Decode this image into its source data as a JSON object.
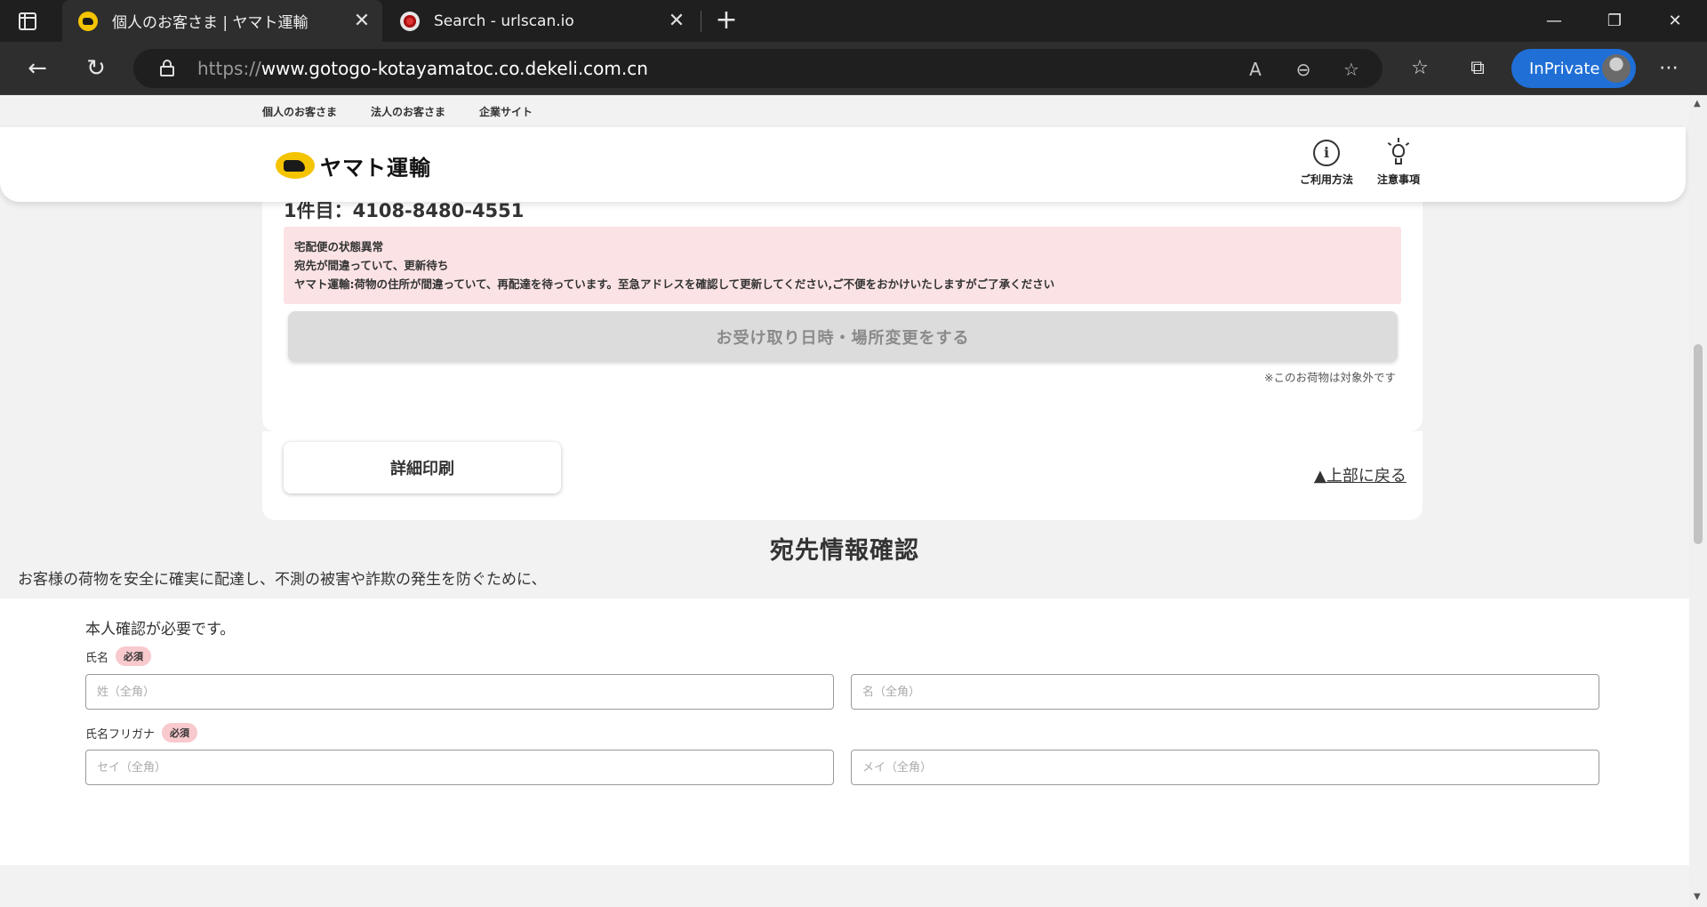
{
  "browser": {
    "tabs": [
      {
        "title": "個人のお客さま | ヤマト運輸",
        "favicon": "yamato-cat-icon",
        "active": true
      },
      {
        "title": "Search - urlscan.io",
        "favicon": "urlscan-icon",
        "active": false
      }
    ],
    "url_scheme": "https://",
    "url_host": "www.gotogo-kotayamatoc.co.dekeli.com.cn",
    "inprivate_label": "InPrivate"
  },
  "topnav": {
    "items": [
      "個人のお客さま",
      "法人のお客さま",
      "企業サイト"
    ]
  },
  "header": {
    "logo_text": "ヤマト運輸",
    "links": [
      {
        "label": "ご利用方法",
        "icon": "info-icon"
      },
      {
        "label": "注意事項",
        "icon": "lightbulb-icon"
      }
    ]
  },
  "tracking": {
    "heading": "1件目：4108-8480-4551",
    "alert_lines": [
      "宅配便の状態異常",
      "宛先が間違っていて、更新待ち",
      "ヤマト運輸:荷物の住所が間違っていて、再配達を待っています。至急アドレスを確認して更新してください,ご不便をおかけいたしますがご了承ください"
    ],
    "change_button": "お受け取り日時・場所変更をする",
    "change_note": "※このお荷物は対象外です",
    "print_button": "詳細印刷"
  },
  "back_to_top": "▲上部に戻る",
  "recipient": {
    "title": "宛先情報確認",
    "intro": "お客様の荷物を安全に確実に配達し、不測の被害や詐欺の発生を防ぐために、",
    "lead": "本人確認が必要です。",
    "required_badge": "必須",
    "name_label": "氏名",
    "last_name_placeholder": "姓（全角）",
    "first_name_placeholder": "名（全角）",
    "kana_label": "氏名フリガナ",
    "last_kana_placeholder": "セイ（全角）",
    "first_kana_placeholder": "メイ（全角）"
  },
  "colors": {
    "alert_bg": "#fbe3e5",
    "badge_bg": "#f8c9cd",
    "inprivate": "#1f6fd6",
    "brand_yellow": "#f5c400"
  }
}
